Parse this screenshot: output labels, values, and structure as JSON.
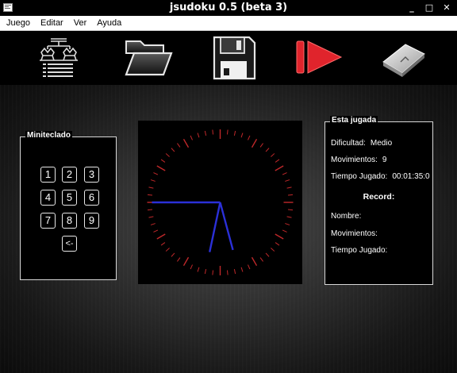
{
  "window": {
    "title": "jsudoku 0.5 (beta 3)",
    "minimize": "_",
    "maximize": "□",
    "close": "✕"
  },
  "menu": [
    "Juego",
    "Editar",
    "Ver",
    "Ayuda"
  ],
  "toolbar": {
    "tools": [
      {
        "icon": "tournament-bracket-icon"
      },
      {
        "icon": "open-folder-icon"
      },
      {
        "icon": "save-floppy-icon"
      },
      {
        "icon": "play-next-icon"
      },
      {
        "icon": "eraser-icon"
      }
    ]
  },
  "keypad": {
    "title": "Miniteclado",
    "keys": [
      "1",
      "2",
      "3",
      "4",
      "5",
      "6",
      "7",
      "8",
      "9",
      "<-"
    ]
  },
  "clock": {
    "hour_hand_points_to_hour": 9,
    "minute_hand_points_to_minute": 32
  },
  "info": {
    "title": "Esta jugada",
    "difficulty_label": "Dificultad:",
    "difficulty_value": "Medio",
    "moves_label": "Movimientos:",
    "moves_value": "9",
    "time_label": "Tiempo Jugado:",
    "time_value": "00:01:35:0",
    "record_title": "Record:",
    "record_name_label": "Nombre:",
    "record_moves_label": "Movimientos:",
    "record_time_label": "Tiempo Jugado:"
  },
  "colors": {
    "clock_ticks": "#c0282a",
    "clock_hands": "#2b30d8",
    "play_icon": "#e0242c"
  }
}
